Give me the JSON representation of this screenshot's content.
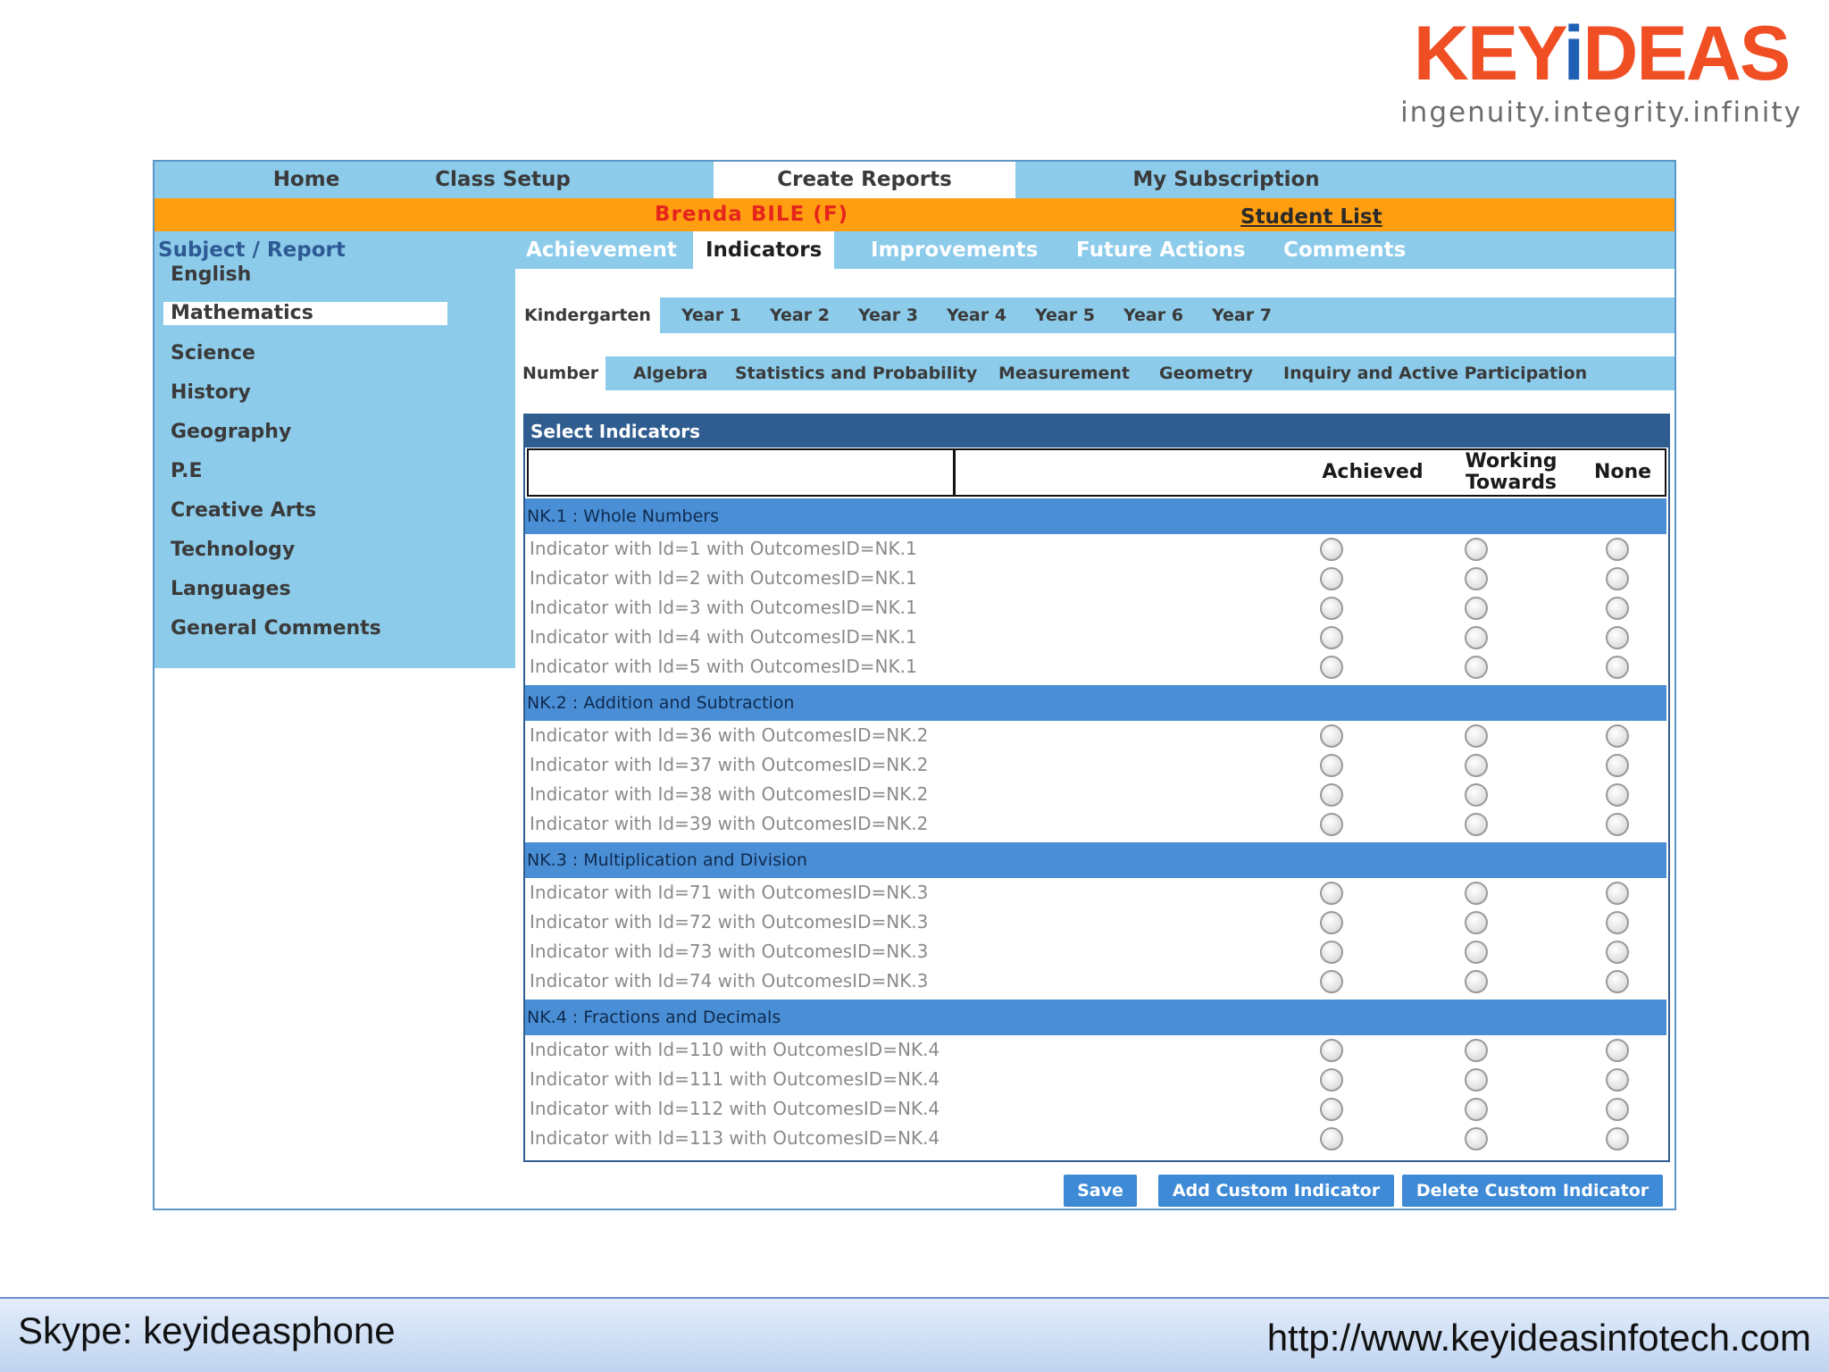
{
  "logo": {
    "word_pre": "KEY",
    "word_i": "i",
    "word_post": "DEAS",
    "tagline": "ingenuity.integrity.infinity"
  },
  "topnav": {
    "tabs": [
      "Home",
      "Class Setup",
      "Create Reports",
      "My Subscription"
    ],
    "active": "Create Reports"
  },
  "student": {
    "name": "Brenda BILE (F)",
    "list_link": "Student List"
  },
  "sidebar": {
    "heading": "Subject / Report",
    "items": [
      "English",
      "Mathematics",
      "Science",
      "History",
      "Geography",
      "P.E",
      "Creative Arts",
      "Technology",
      "Languages",
      "General Comments"
    ],
    "active": "Mathematics"
  },
  "subtabs": {
    "tabs": [
      "Achievement",
      "Indicators",
      "Improvements",
      "Future Actions",
      "Comments"
    ],
    "active": "Indicators"
  },
  "yeartabs": {
    "tabs": [
      "Kindergarten",
      "Year 1",
      "Year 2",
      "Year 3",
      "Year 4",
      "Year 5",
      "Year 6",
      "Year 7"
    ],
    "active": "Kindergarten"
  },
  "strandtabs": {
    "tabs": [
      "Number",
      "Algebra",
      "Statistics and Probability",
      "Measurement",
      "Geometry",
      "Inquiry and Active Participation"
    ],
    "active": "Number"
  },
  "panel": {
    "title": "Select Indicators",
    "columns": {
      "achieved": "Achieved",
      "working_1": "Working",
      "working_2": "Towards",
      "none": "None"
    },
    "groups": [
      {
        "label": "NK.1 : Whole Numbers",
        "rows": [
          "Indicator with Id=1 with OutcomesID=NK.1",
          "Indicator with Id=2 with OutcomesID=NK.1",
          "Indicator with Id=3 with OutcomesID=NK.1",
          "Indicator with Id=4 with OutcomesID=NK.1",
          "Indicator with Id=5 with OutcomesID=NK.1"
        ]
      },
      {
        "label": "NK.2 : Addition and Subtraction",
        "rows": [
          "Indicator with Id=36 with OutcomesID=NK.2",
          "Indicator with Id=37 with OutcomesID=NK.2",
          "Indicator with Id=38 with OutcomesID=NK.2",
          "Indicator with Id=39 with OutcomesID=NK.2"
        ]
      },
      {
        "label": "NK.3 : Multiplication and Division",
        "rows": [
          "Indicator with Id=71 with OutcomesID=NK.3",
          "Indicator with Id=72 with OutcomesID=NK.3",
          "Indicator with Id=73 with OutcomesID=NK.3",
          "Indicator with Id=74 with OutcomesID=NK.3"
        ]
      },
      {
        "label": "NK.4 : Fractions and Decimals",
        "rows": [
          "Indicator with Id=110 with OutcomesID=NK.4",
          "Indicator with Id=111 with OutcomesID=NK.4",
          "Indicator with Id=112 with OutcomesID=NK.4",
          "Indicator with Id=113 with OutcomesID=NK.4"
        ]
      }
    ]
  },
  "buttons": {
    "save": "Save",
    "add": "Add Custom Indicator",
    "delete": "Delete Custom Indicator"
  },
  "footer": {
    "skype": "Skype: keyideasphone",
    "url": "http://www.keyideasinfotech.com"
  },
  "colors": {
    "nav_blue": "#8ccbea",
    "orange_bar": "#ff9e10",
    "group_blue": "#4a8fd6",
    "panel_navy": "#2f5d90",
    "logo_orange": "#f04e23",
    "logo_blue": "#1f5fb4"
  }
}
